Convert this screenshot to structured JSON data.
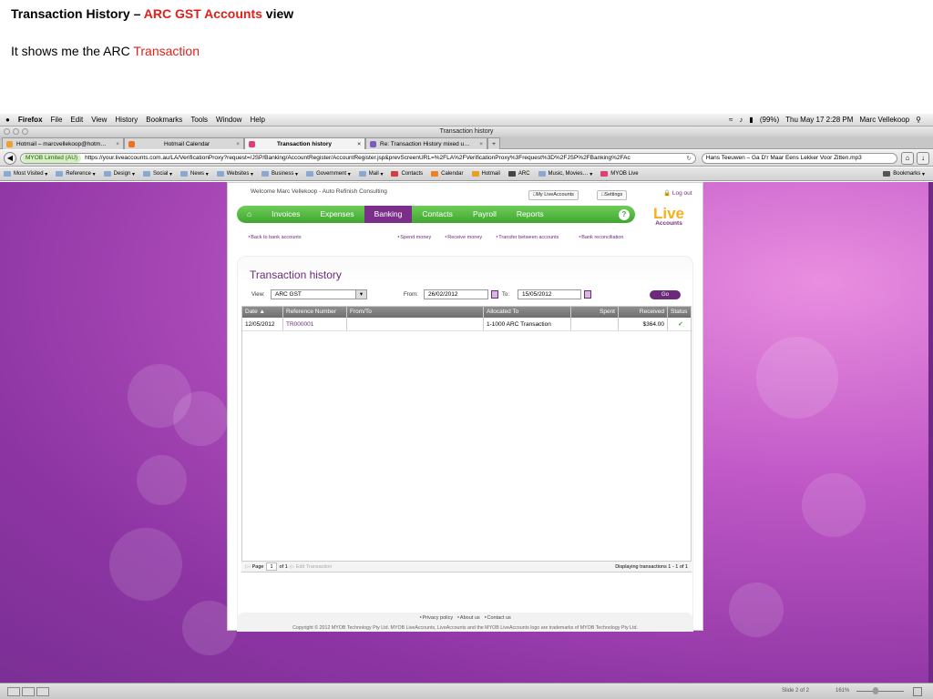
{
  "slide": {
    "title_pre": "Transaction History – ",
    "title_red": "ARC GST Accounts",
    "title_post": " view",
    "subtitle_pre": "It shows me the ARC ",
    "subtitle_red": "Transaction"
  },
  "menubar": {
    "app": "Firefox",
    "items": [
      "File",
      "Edit",
      "View",
      "History",
      "Bookmarks",
      "Tools",
      "Window",
      "Help"
    ],
    "status": {
      "battery": "(99%)",
      "datetime": "Thu May 17  2:28 PM",
      "user": "Marc Vellekoop"
    }
  },
  "window": {
    "title": "Transaction history"
  },
  "tabs": [
    {
      "label": "Hotmail – marcvellekoop@hotm…",
      "color": "#f0a030"
    },
    {
      "label": "Hotmail Calendar",
      "color": "#f07020"
    },
    {
      "label": "Transaction history",
      "color": "#e04070"
    },
    {
      "label": "Re: Transaction History mixed u…",
      "color": "#7a5ac0"
    }
  ],
  "nav": {
    "identity": "MYOB Limited (AU)",
    "url": "https://your.liveaccounts.com.au/LA/VerificationProxy?request=/JSP/Banking/AccountRegister/AccountRegister.jsp&prevScreenURL=%2FLA%2FVerificationProxy%3Frequest%3D%2FJSP%2FBanking%2FAc",
    "search": "Hans Teeuwen – Ga D'r Maar Eens Lekker Voor Zitten.mp3"
  },
  "bookmarks": {
    "items": [
      "Most Visited",
      "Reference",
      "Design",
      "Social",
      "News",
      "Websites",
      "Business",
      "Government",
      "Mail",
      "Contacts",
      "Calendar",
      "Hotmail",
      "ARC",
      "Music, Movies…",
      "MYOB Live"
    ],
    "right": "Bookmarks"
  },
  "app": {
    "welcome": "Welcome Marc Vellekoop - Auto Refinish Consulting",
    "my_liveaccounts": "My LiveAccounts",
    "settings": "Settings",
    "logout": "Log out",
    "nav": [
      "Invoices",
      "Expenses",
      "Banking",
      "Contacts",
      "Payroll",
      "Reports"
    ],
    "help": "?",
    "logo_top": "Live",
    "logo_bottom": "Accounts",
    "back_link": "Back to bank accounts",
    "sublinks": [
      "Spend money",
      "Receive money",
      "Transfer between accounts",
      "Bank reconciliation"
    ],
    "panel_title": "Transaction history",
    "view_label": "View:",
    "view_value": "ARC GST",
    "from_label": "From:",
    "from_value": "26/02/2012",
    "to_label": "To:",
    "to_value": "15/05/2012",
    "go": "Go",
    "columns": [
      "Date ▲",
      "Reference Number",
      "From/To",
      "Allocated To",
      "Spent",
      "Received",
      "Status"
    ],
    "rows": [
      {
        "date": "12/05/2012",
        "ref": "TR000001",
        "fromto": "",
        "allocated": "1-1000 ARC Transaction",
        "spent": "",
        "received": "$364.00"
      }
    ],
    "pager": {
      "page": "Page",
      "page_num": "1",
      "of": "of 1",
      "edit": "Edit Transaction",
      "display": "Displaying transactions 1 - 1 of 1"
    },
    "footer_links": [
      "Privacy policy",
      "About us",
      "Contact us"
    ],
    "copyright": "Copyright © 2012 MYOB Technology Pty Ltd. MYOB LiveAccounts, LiveAccounts and the MYOB LiveAccounts logo are trademarks of MYOB Technology Pty Ltd."
  },
  "ppt": {
    "slide": "Slide 2 of 2",
    "zoom": "161%"
  }
}
